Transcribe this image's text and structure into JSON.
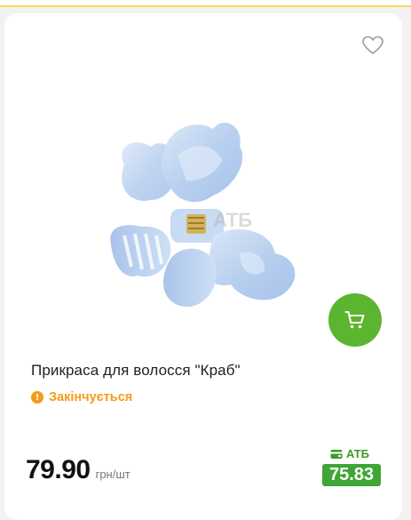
{
  "product": {
    "title": "Прикраса для волосся \"Краб\"",
    "stock_status": "Закінчується",
    "price": "79.90",
    "price_unit": "грн/шт",
    "loyalty_label": "АТБ",
    "loyalty_price": "75.83",
    "image_watermark": "АТБ"
  },
  "icons": {
    "favorite": "heart-outline-icon",
    "cart": "shopping-cart-icon",
    "stock": "exclamation-circle-icon",
    "loyalty": "wallet-card-icon"
  },
  "colors": {
    "accent_green": "#5cb52e",
    "loyalty_green": "#3fa535",
    "warning_orange": "#f59c18",
    "top_border_yellow": "#f6d75a"
  }
}
